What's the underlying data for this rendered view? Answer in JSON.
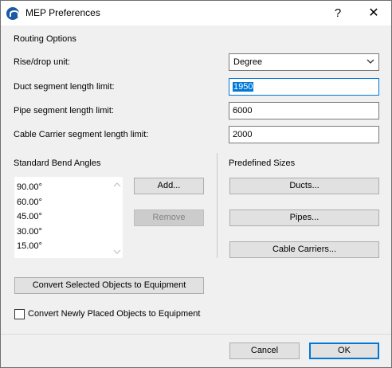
{
  "window": {
    "title": "MEP Preferences",
    "help_glyph": "?",
    "close_glyph": "✕"
  },
  "routing": {
    "section_label": "Routing Options",
    "rise_drop_label": "Rise/drop unit:",
    "rise_drop_value": "Degree",
    "duct_label": "Duct segment length limit:",
    "duct_value": "1950",
    "pipe_label": "Pipe segment length limit:",
    "pipe_value": "6000",
    "cable_label": "Cable Carrier segment length limit:",
    "cable_value": "2000"
  },
  "bend_angles": {
    "section_label": "Standard Bend Angles",
    "items": [
      "90.00°",
      "60.00°",
      "45.00°",
      "30.00°",
      "15.00°"
    ],
    "add_label": "Add...",
    "remove_label": "Remove"
  },
  "predefined": {
    "section_label": "Predefined Sizes",
    "ducts_label": "Ducts...",
    "pipes_label": "Pipes...",
    "cable_carriers_label": "Cable Carriers..."
  },
  "convert": {
    "button_label": "Convert Selected Objects to Equipment",
    "checkbox_label": "Convert Newly Placed Objects to Equipment",
    "checkbox_checked": false
  },
  "footer": {
    "cancel_label": "Cancel",
    "ok_label": "OK"
  },
  "colors": {
    "accent": "#0078d7",
    "dialog_bg": "#f0f0f0"
  }
}
